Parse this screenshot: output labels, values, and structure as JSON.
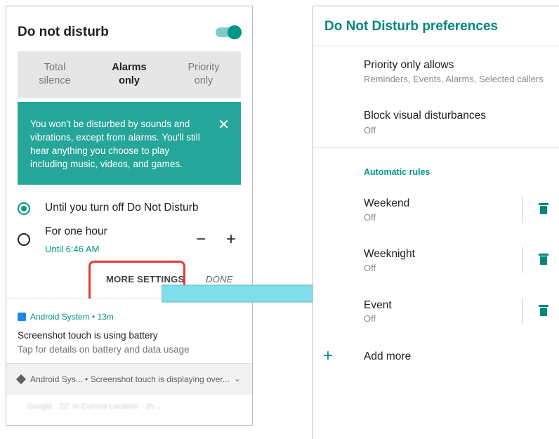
{
  "left_panel": {
    "title": "Do not disturb",
    "modes": [
      {
        "line1": "Total",
        "line2": "silence"
      },
      {
        "line1": "Alarms",
        "line2": "only"
      },
      {
        "line1": "Priority",
        "line2": "only"
      }
    ],
    "info_text": "You won't be disturbed by sounds and vibrations, except from alarms. You'll still hear anything you choose to play including music, videos, and games.",
    "info_close": "✕",
    "option1": "Until you turn off Do Not Disturb",
    "option2": "For one hour",
    "option2_until": "Until 6:46 AM",
    "minus": "−",
    "plus": "+",
    "more_settings": "MORE SETTINGS",
    "done": "DONE",
    "notif1": {
      "app": "Android System • 13m",
      "title": "Screenshot touch is using battery",
      "subtitle": "Tap for details on battery and data usage"
    },
    "notif2": {
      "text": "Android Sys... • Screenshot touch is displaying over...",
      "chevron": "⌄"
    },
    "blur_text": "Google · 22° in Current Location · 2h ⌄"
  },
  "right_panel": {
    "title": "Do Not Disturb preferences",
    "priority_title": "Priority only allows",
    "priority_sub": "Reminders, Events, Alarms, Selected callers",
    "block_title": "Block visual disturbances",
    "block_sub": "Off",
    "section": "Automatic rules",
    "rules": [
      {
        "name": "Weekend",
        "status": "Off"
      },
      {
        "name": "Weeknight",
        "status": "Off"
      },
      {
        "name": "Event",
        "status": "Off"
      }
    ],
    "add_plus": "+",
    "add_more": "Add more"
  },
  "colors": {
    "accent": "#009688",
    "info_bg": "#26a69a",
    "highlight_box": "#e53935",
    "arrow": "#80deea"
  }
}
